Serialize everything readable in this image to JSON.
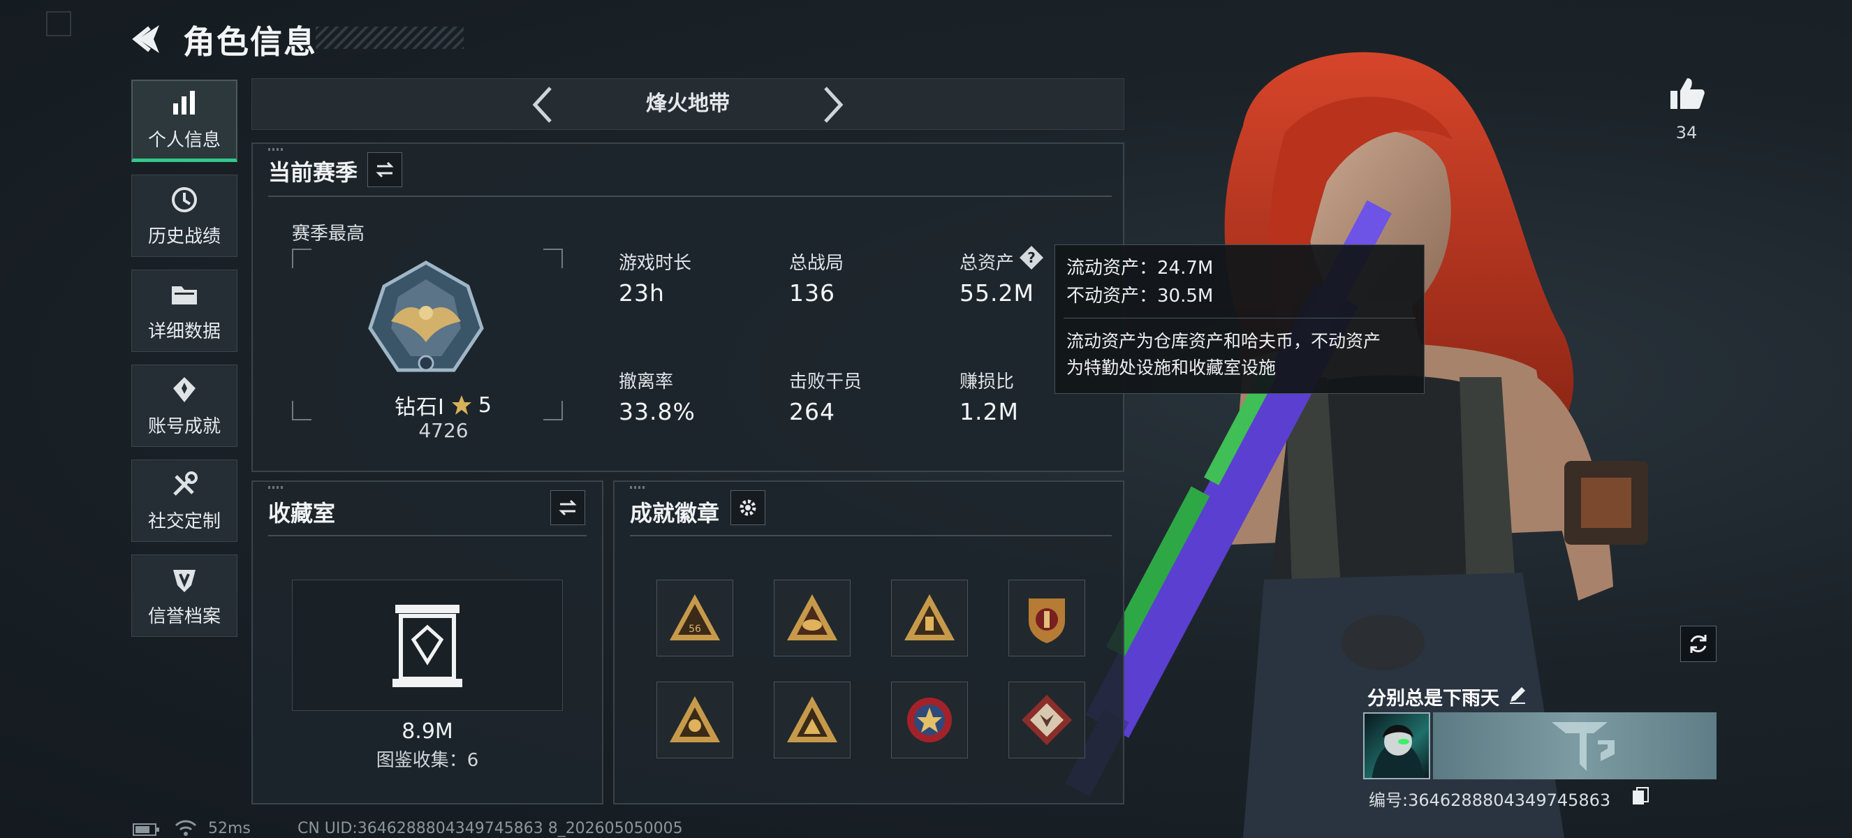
{
  "header": {
    "title": "角色信息"
  },
  "nav": {
    "items": [
      {
        "label": "个人信息",
        "icon": "bar-chart-icon",
        "active": true
      },
      {
        "label": "历史战绩",
        "icon": "history-clock-icon",
        "active": false
      },
      {
        "label": "详细数据",
        "icon": "folder-icon",
        "active": false
      },
      {
        "label": "账号成就",
        "icon": "achievement-medal-icon",
        "active": false
      },
      {
        "label": "社交定制",
        "icon": "tools-icon",
        "active": false
      },
      {
        "label": "信誉档案",
        "icon": "shield-icon",
        "active": false
      }
    ]
  },
  "mode": {
    "title": "烽火地带"
  },
  "season": {
    "section_title": "当前赛季",
    "best_label": "赛季最高",
    "rank_name": "钻石I",
    "rank_stars": "5",
    "rank_score": "4726",
    "stats": [
      {
        "label": "游戏时长",
        "value": "23h"
      },
      {
        "label": "总战局",
        "value": "136"
      },
      {
        "label": "总资产",
        "value": "55.2M"
      },
      {
        "label": "撤离率",
        "value": "33.8%"
      },
      {
        "label": "击败干员",
        "value": "264"
      },
      {
        "label": "赚损比",
        "value": "1.2M"
      }
    ]
  },
  "tooltip": {
    "liquid": "流动资产：24.7M",
    "fixed": "不动资产：30.5M",
    "desc1": "流动资产为仓库资产和哈夫币，不动资产",
    "desc2": "为特勤处设施和收藏室设施"
  },
  "collection": {
    "title": "收藏室",
    "value": "8.9M",
    "count": "图鉴收集：6"
  },
  "badges": {
    "title": "成就徽章",
    "small_text": "56"
  },
  "social": {
    "likes": "34"
  },
  "player": {
    "name": "分别总是下雨天",
    "id": "编号:3646288804349745863"
  },
  "status": {
    "ping": "52ms",
    "uid": "CN UID:3646288804349745863 8_202605050005"
  },
  "colors": {
    "accent": "#33c98a",
    "panel": "#1e262c",
    "border": "#3a444b",
    "hair": "#c2341f",
    "weapon": "#5b3fd1"
  }
}
